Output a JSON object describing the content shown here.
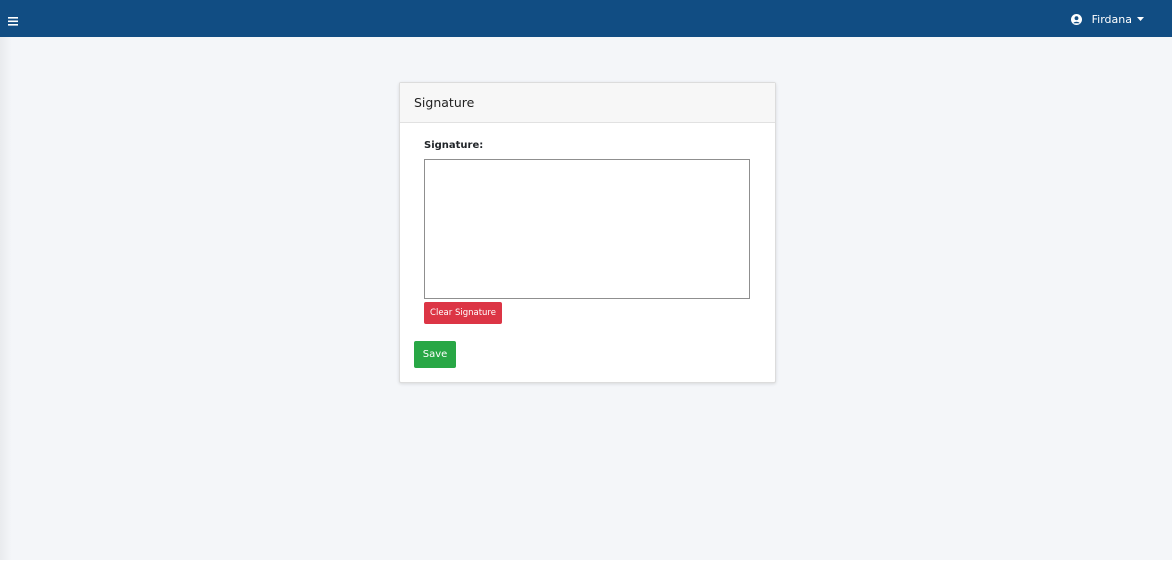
{
  "navbar": {
    "menu_icon": "hamburger-icon",
    "user_icon": "user-circle-icon",
    "user_name": "Firdana",
    "dropdown_icon": "caret-down-icon",
    "background_color": "#114d83"
  },
  "card": {
    "title": "Signature",
    "signature_label": "Signature:",
    "clear_button_label": "Clear Signature",
    "save_button_label": "Save"
  },
  "colors": {
    "clear_button": "#dc3545",
    "save_button": "#28a745",
    "page_background": "#f4f6f9"
  }
}
